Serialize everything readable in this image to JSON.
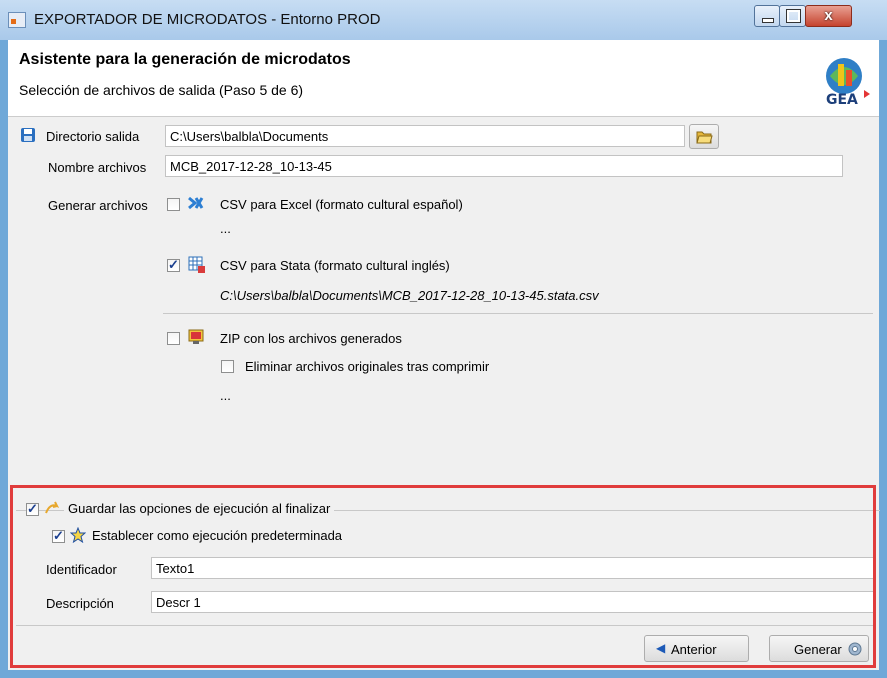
{
  "window": {
    "title": "EXPORTADOR DE MICRODATOS - Entorno PROD",
    "close_glyph": "x"
  },
  "header": {
    "title": "Asistente para la generación de microdatos",
    "subtitle": "Selección de archivos de salida (Paso 5 de 6)",
    "logo_text": "GEA"
  },
  "output": {
    "dir_label": "Directorio salida",
    "dir_value": "C:\\Users\\balbla\\Documents",
    "name_label": "Nombre archivos",
    "name_value": "MCB_2017-12-28_10-13-45",
    "generate_label": "Generar archivos"
  },
  "options": [
    {
      "label": "CSV para Excel (formato cultural español)",
      "checked": false,
      "detail": "..."
    },
    {
      "label": "CSV para Stata (formato cultural inglés)",
      "checked": true,
      "detail": "C:\\Users\\balbla\\Documents\\MCB_2017-12-28_10-13-45.stata.csv"
    },
    {
      "label": "ZIP con los archivos generados",
      "checked": false,
      "detail": "..."
    }
  ],
  "zip_sub": {
    "label": "Eliminar archivos originales tras comprimir",
    "checked": false
  },
  "save_group": {
    "label": "Guardar las opciones de ejecución al finalizar",
    "checked": true,
    "default_label": "Establecer como ejecución predeterminada",
    "default_checked": true,
    "id_label": "Identificador",
    "id_value": "Texto1",
    "desc_label": "Descripción",
    "desc_value": "Descr 1"
  },
  "buttons": {
    "back": "Anterior",
    "generate": "Generar"
  },
  "colors": {
    "highlight": "#e03c3c",
    "titlebar": "#a9c9ea"
  }
}
